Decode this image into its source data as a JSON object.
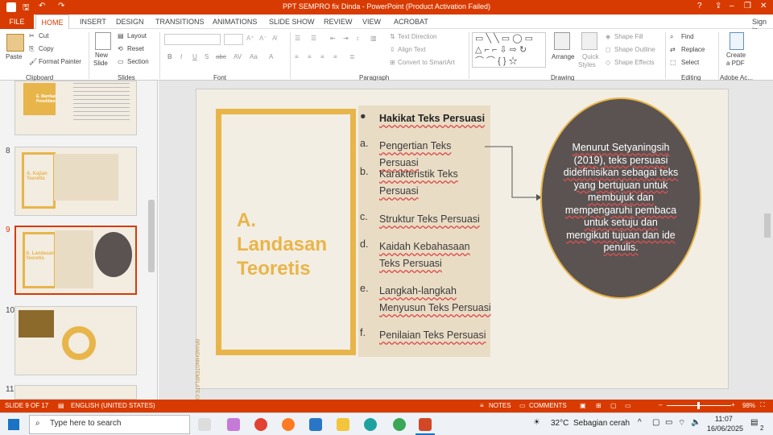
{
  "window": {
    "title": "PPT SEMPRO fix Dinda  -  PowerPoint (Product Activation Failed)",
    "signin": "Sign in"
  },
  "menu": {
    "file": "FILE",
    "home": "HOME",
    "items": [
      "INSERT",
      "DESIGN",
      "TRANSITIONS",
      "ANIMATIONS",
      "SLIDE SHOW",
      "REVIEW",
      "VIEW",
      "ACROBAT"
    ]
  },
  "ribbon": {
    "clipboard": {
      "paste": "Paste",
      "cut": "Cut",
      "copy": "Copy",
      "format_painter": "Format Painter",
      "label": "Clipboard"
    },
    "slides": {
      "new_slide": "New",
      "new_slide2": "Slide",
      "layout": "Layout",
      "reset": "Reset",
      "section": "Section",
      "label": "Slides"
    },
    "font": {
      "label": "Font"
    },
    "paragraph": {
      "text_direction": "Text Direction",
      "align_text": "Align Text",
      "convert": "Convert to SmartArt",
      "label": "Paragraph"
    },
    "drawing": {
      "arrange": "Arrange",
      "quick_styles": "Quick",
      "quick_styles2": "Styles",
      "shape_fill": "Shape Fill",
      "shape_outline": "Shape Outline",
      "shape_effects": "Shape Effects",
      "label": "Drawing"
    },
    "editing": {
      "find": "Find",
      "replace": "Replace",
      "select": "Select",
      "label": "Editing"
    },
    "adobe": {
      "create_pdf": "Create",
      "create_pdf2": "a PDF",
      "label": "Adobe Ac..."
    }
  },
  "thumbnails": [
    {
      "num": "",
      "title": "E. Manfaat Penelitian"
    },
    {
      "num": "8",
      "title": "A. Kajian Teoretis"
    },
    {
      "num": "9",
      "title": "A. Landasan Teoretis"
    },
    {
      "num": "10",
      "title": ""
    },
    {
      "num": "11",
      "title": ""
    }
  ],
  "slide": {
    "heading": "A. Landasan Teoretis",
    "vertical_text": "BRANDHINGTEMPLATE.COM",
    "items": [
      {
        "marker": "●",
        "text": "Hakikat Teks Persuasi"
      },
      {
        "marker": "a.",
        "text": "Pengertian Teks Persuasi"
      },
      {
        "marker": "b.",
        "text": "Karakteristik Teks Persuasi"
      },
      {
        "marker": "c.",
        "text": "Struktur Teks Persuasi"
      },
      {
        "marker": "d.",
        "text": "Kaidah Kebahasaan Teks Persuasi"
      },
      {
        "marker": "e.",
        "text": "Langkah-langkah Menyusun Teks Persuasi"
      },
      {
        "marker": "f.",
        "text": "Penilaian Teks Persuasi"
      }
    ],
    "circle_text": "Menurut Setyaningsih (2019), teks persuasi didefinisikan sebagai teks yang bertujuan untuk membujuk dan mempengaruhi pembaca untuk setuju dan mengikuti tujuan dan ide penulis."
  },
  "status": {
    "slide_info": "SLIDE 9 OF 17",
    "language": "ENGLISH (UNITED STATES)",
    "notes": "NOTES",
    "comments": "COMMENTS",
    "zoom": "98%"
  },
  "taskbar": {
    "search": "Type here to search",
    "temp": "32°C",
    "weather": "Sebagian cerah",
    "time": "11:07",
    "date": "16/06/2025",
    "notif": "2"
  },
  "colors": {
    "accent": "#d83b01",
    "slide_gold": "#e8b54a",
    "circle": "#5a5352"
  }
}
